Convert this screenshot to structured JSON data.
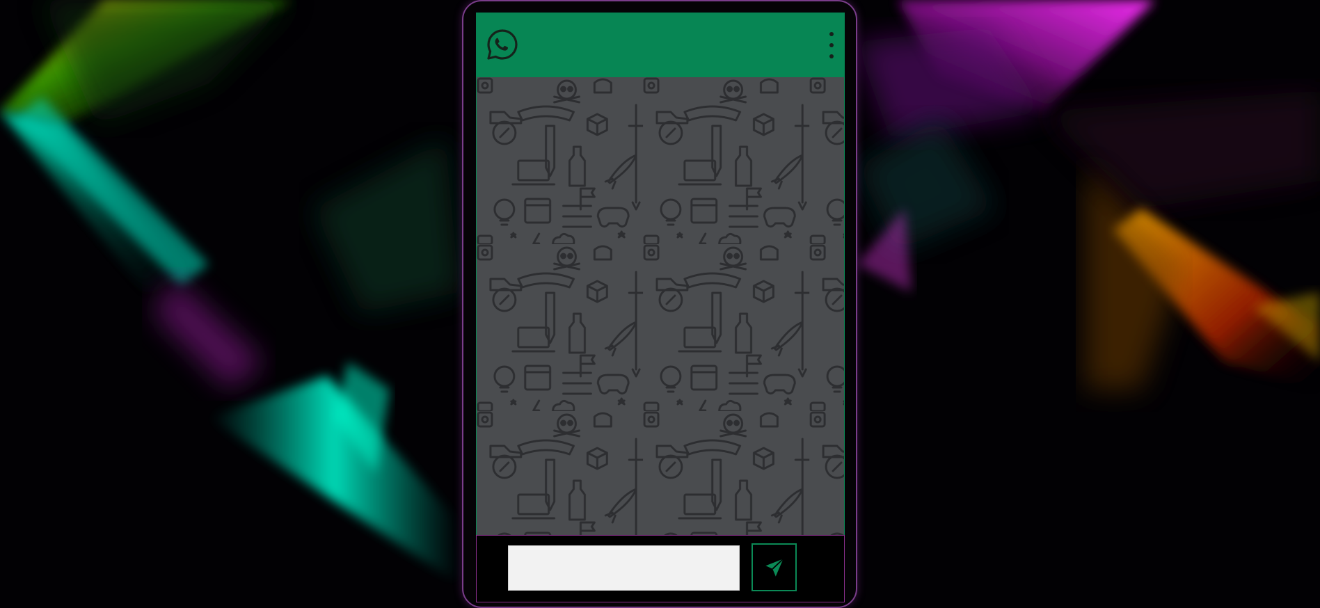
{
  "app": {
    "name": "WhatsApp",
    "brand_color": "#078654",
    "logo_icon": "whatsapp-logo-icon",
    "menu_icon": "kebab-menu-icon"
  },
  "composer": {
    "input_value": "",
    "input_placeholder": "",
    "send_icon": "send-icon"
  }
}
